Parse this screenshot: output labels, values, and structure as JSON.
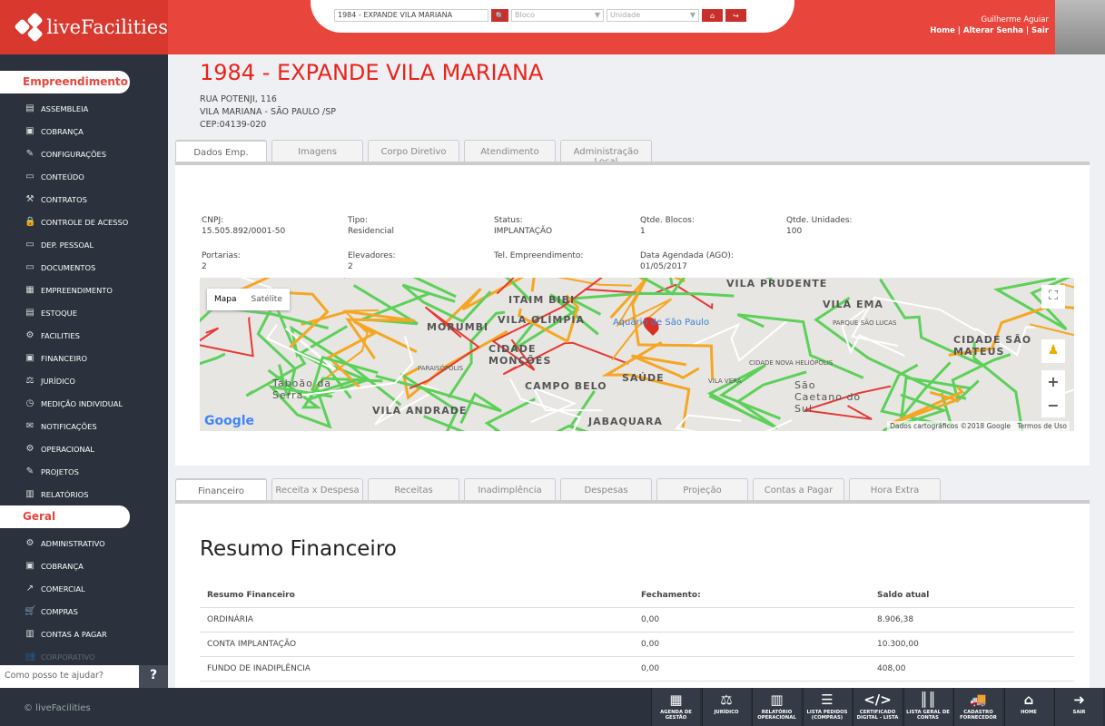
{
  "header": {
    "logo": "liveFacilities",
    "search_value": "1984 - EXPANDE VILA MARIANA",
    "bloco_placeholder": "Bloco",
    "unidade_placeholder": "Unidade",
    "user_name": "Guilherme Aguiar",
    "links": [
      "Home",
      "Alterar Senha",
      "Sair"
    ]
  },
  "sidebar": {
    "section1": "Empreendimento",
    "items1": [
      {
        "icon": "▤",
        "label": "ASSEMBLEIA"
      },
      {
        "icon": "▣",
        "label": "COBRANÇA"
      },
      {
        "icon": "✎",
        "label": "CONFIGURAÇÕES"
      },
      {
        "icon": "▭",
        "label": "CONTEÚDO"
      },
      {
        "icon": "⚒",
        "label": "CONTRATOS"
      },
      {
        "icon": "🔒",
        "label": "CONTROLE DE ACESSO"
      },
      {
        "icon": "▭",
        "label": "DEP. PESSOAL"
      },
      {
        "icon": "▭",
        "label": "DOCUMENTOS"
      },
      {
        "icon": "▦",
        "label": "EMPREENDIMENTO"
      },
      {
        "icon": "▤",
        "label": "ESTOQUE"
      },
      {
        "icon": "⚙",
        "label": "FACILITIES"
      },
      {
        "icon": "▣",
        "label": "FINANCEIRO"
      },
      {
        "icon": "⚖",
        "label": "JURÍDICO"
      },
      {
        "icon": "◷",
        "label": "MEDIÇÃO INDIVIDUAL"
      },
      {
        "icon": "✉",
        "label": "NOTIFICAÇÕES"
      },
      {
        "icon": "⚙",
        "label": "OPERACIONAL"
      },
      {
        "icon": "✎",
        "label": "PROJETOS"
      },
      {
        "icon": "▥",
        "label": "RELATÓRIOS"
      }
    ],
    "section2": "Geral",
    "items2": [
      {
        "icon": "⚙",
        "label": "ADMINISTRATIVO"
      },
      {
        "icon": "▣",
        "label": "COBRANÇA"
      },
      {
        "icon": "↗",
        "label": "COMERCIAL"
      },
      {
        "icon": "🛒",
        "label": "COMPRAS"
      },
      {
        "icon": "▥",
        "label": "CONTAS A PAGAR"
      },
      {
        "icon": "👥",
        "label": "CORPORATIVO"
      }
    ],
    "help_placeholder": "Como posso te ajudar?",
    "help_icon": "?"
  },
  "page": {
    "title": "1984 - EXPANDE VILA MARIANA",
    "address": [
      "RUA POTENJI, 116",
      "VILA MARIANA - SÃO PAULO /SP",
      "CEP:04139-020"
    ]
  },
  "tabs1": [
    "Dados Emp.",
    "Imagens",
    "Corpo Diretivo",
    "Atendimento",
    "Administração Local"
  ],
  "info": [
    {
      "label": "CNPJ:",
      "value": "15.505.892/0001-50"
    },
    {
      "label": "Tipo:",
      "value": "Residencial"
    },
    {
      "label": "Status:",
      "value": "IMPLANTAÇÃO"
    },
    {
      "label": "Qtde. Blocos:",
      "value": "1"
    },
    {
      "label": "Qtde. Unidades:",
      "value": "100"
    },
    {
      "label": "Portarias:",
      "value": "2"
    },
    {
      "label": "Elevadores:",
      "value": "2"
    },
    {
      "label": "Tel. Empreendimento:",
      "value": ""
    },
    {
      "label": "Data Agendada (AGO):",
      "value": "01/05/2017"
    }
  ],
  "map": {
    "type_buttons": [
      "Mapa",
      "Satélite"
    ],
    "labels": [
      "ITAIM BIBI",
      "VILA OLÍMPIA",
      "MORUMBI",
      "CIDADE MONÇÕES",
      "CAMPO BELO",
      "SAÚDE",
      "JABAQUARA",
      "VILA ANDRADE",
      "Taboão da Serra",
      "VILA PRUDENTE",
      "VILA EMA",
      "CIDADE SÃO MATEUS",
      "São Caetano do Sul",
      "Aquário de São Paulo",
      "PARQUE SÃO LUCAS",
      "CIDADE NOVA HELIÓPOLIS",
      "VILA VERA",
      "PARAISÓPOLIS"
    ],
    "attribution": "Dados cartográficos ©2018 Google",
    "terms": "Termos de Uso",
    "google": "Google"
  },
  "tabs2": [
    "Financeiro",
    "Receita x Despesa",
    "Receitas",
    "Inadimplência",
    "Despesas",
    "Projeção",
    "Contas a Pagar",
    "Hora Extra"
  ],
  "financial": {
    "heading": "Resumo Financeiro",
    "columns": [
      "Resumo Financeiro",
      "Fechamento:",
      "Saldo atual"
    ],
    "rows": [
      [
        "ORDINÁRIA",
        "0,00",
        "8.906,38"
      ],
      [
        "CONTA IMPLANTAÇÃO",
        "0,00",
        "10.300,00"
      ],
      [
        "FUNDO DE INADIPLÊNCIA",
        "0,00",
        "408,00"
      ]
    ]
  },
  "footer": {
    "copyright": "© liveFacilities",
    "buttons": [
      {
        "icon": "▦",
        "label": "AGENDA DE GESTÃO"
      },
      {
        "icon": "⚖",
        "label": "JURÍDICO"
      },
      {
        "icon": "▥",
        "label": "RELATÓRIO OPERACIONAL"
      },
      {
        "icon": "☰",
        "label": "LISTA PEDIDOS (COMPRAS)"
      },
      {
        "icon": "</>",
        "label": "CERTIFICADO DIGITAL - LISTA"
      },
      {
        "icon": "║║",
        "label": "LISTA GERAL DE CONTAS"
      },
      {
        "icon": "🚚",
        "label": "CADASTRO FORNECEDOR"
      },
      {
        "icon": "⌂",
        "label": "HOME"
      },
      {
        "icon": "➜",
        "label": "SAIR"
      }
    ]
  },
  "colors": {
    "brand": "#e8453c",
    "sidebar": "#2b323d",
    "title": "#e8241c"
  }
}
